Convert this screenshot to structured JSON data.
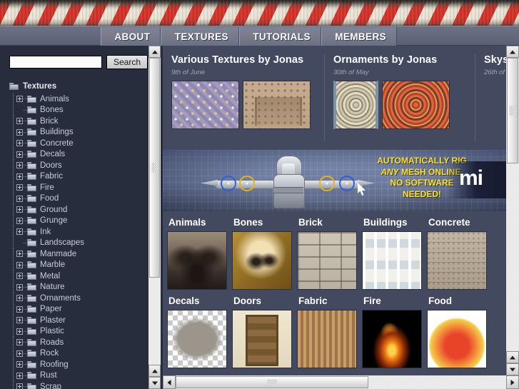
{
  "nav": {
    "tabs": [
      {
        "label": "ABOUT",
        "marker": "chevron-right-icon"
      },
      {
        "label": "TEXTURES",
        "marker": "chevron-right-icon"
      },
      {
        "label": "TUTORIALS",
        "marker": "chevron-right-icon"
      },
      {
        "label": "MEMBERS",
        "marker": "chevron-right-icon"
      }
    ]
  },
  "sidebar": {
    "search": {
      "value": "",
      "placeholder": "",
      "button_label": "Search"
    },
    "tree": {
      "root_label": "Textures",
      "root_icon": "open-folder-icon",
      "nodes": [
        {
          "label": "Animals",
          "expandable": true
        },
        {
          "label": "Bones",
          "expandable": false
        },
        {
          "label": "Brick",
          "expandable": true
        },
        {
          "label": "Buildings",
          "expandable": true
        },
        {
          "label": "Concrete",
          "expandable": true
        },
        {
          "label": "Decals",
          "expandable": true
        },
        {
          "label": "Doors",
          "expandable": true
        },
        {
          "label": "Fabric",
          "expandable": true
        },
        {
          "label": "Fire",
          "expandable": true
        },
        {
          "label": "Food",
          "expandable": true
        },
        {
          "label": "Ground",
          "expandable": true
        },
        {
          "label": "Grunge",
          "expandable": true
        },
        {
          "label": "Ink",
          "expandable": true
        },
        {
          "label": "Landscapes",
          "expandable": false
        },
        {
          "label": "Manmade",
          "expandable": true
        },
        {
          "label": "Marble",
          "expandable": true
        },
        {
          "label": "Metal",
          "expandable": true
        },
        {
          "label": "Nature",
          "expandable": true
        },
        {
          "label": "Ornaments",
          "expandable": true
        },
        {
          "label": "Paper",
          "expandable": true
        },
        {
          "label": "Plaster",
          "expandable": true
        },
        {
          "label": "Plastic",
          "expandable": true
        },
        {
          "label": "Roads",
          "expandable": true
        },
        {
          "label": "Rock",
          "expandable": true
        },
        {
          "label": "Roofing",
          "expandable": true
        },
        {
          "label": "Rust",
          "expandable": true
        },
        {
          "label": "Scrap",
          "expandable": true
        }
      ]
    }
  },
  "news": [
    {
      "title": "Various Textures by Jonas",
      "date": "9th of June",
      "thumbs": [
        {
          "name": "persian-tile-texture"
        },
        {
          "name": "carved-stone-facade-texture"
        }
      ]
    },
    {
      "title": "Ornaments by Jonas",
      "date": "30th of May",
      "thumbs": [
        {
          "name": "ornament-dome-texture"
        },
        {
          "name": "ornament-mandala-texture"
        }
      ]
    },
    {
      "title": "Skys",
      "date": "26th of",
      "thumbs": []
    }
  ],
  "banner": {
    "line1": "AUTOMATICALLY RIG",
    "line2_italic": "ANY",
    "line2_rest": " MESH ONLINE,",
    "line3": "NO SOFTWARE",
    "line4": "NEEDED!",
    "logo": "mi",
    "text_color": "#ffe21f"
  },
  "categories": [
    [
      {
        "label": "Animals",
        "thumb": "gorilla-thumbnail"
      },
      {
        "label": "Bones",
        "thumb": "skull-thumbnail"
      },
      {
        "label": "Brick",
        "thumb": "brick-wall-thumbnail"
      },
      {
        "label": "Buildings",
        "thumb": "office-building-thumbnail"
      },
      {
        "label": "Concrete",
        "thumb": "concrete-thumbnail"
      }
    ],
    [
      {
        "label": "Decals",
        "thumb": "decal-alpha-thumbnail"
      },
      {
        "label": "Doors",
        "thumb": "wooden-door-thumbnail"
      },
      {
        "label": "Fabric",
        "thumb": "burlap-fabric-thumbnail"
      },
      {
        "label": "Fire",
        "thumb": "fire-ring-thumbnail"
      },
      {
        "label": "Food",
        "thumb": "apple-thumbnail"
      }
    ]
  ],
  "colors": {
    "sidebar_bg": "#272d3c",
    "content_bg": "#434a60",
    "tabbar_bg": "#636a7d",
    "accent_red": "#e0503a",
    "ad_yellow": "#ffe21f"
  }
}
